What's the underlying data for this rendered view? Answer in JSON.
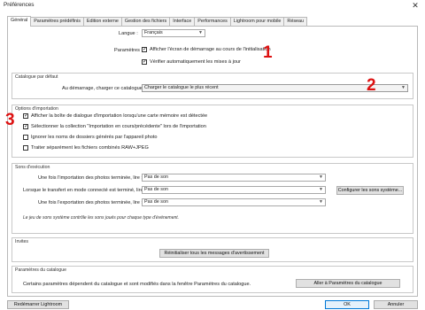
{
  "window": {
    "title": "Préférences",
    "close_glyph": "✕"
  },
  "tabs": [
    "Général",
    "Paramètres prédéfinis",
    "Edition externe",
    "Gestion des fichiers",
    "Interface",
    "Performances",
    "Lightroom pour mobile",
    "Réseau"
  ],
  "active_tab": 0,
  "general": {
    "language_label": "Langue :",
    "language_value": "Français",
    "params_label": "Paramètres :",
    "show_splash": {
      "label": "Afficher l'écran de démarrage au cours de l'initialisation",
      "checked": true
    },
    "check_updates": {
      "label": "Vérifier automatiquement les mises à jour",
      "checked": true
    }
  },
  "default_catalog": {
    "title": "Catalogue par défaut",
    "startup_label": "Au démarrage, charger ce catalogue :",
    "startup_value": "Charger le catalogue le plus récent"
  },
  "import_options": {
    "title": "Options d'importation",
    "items": [
      {
        "label": "Afficher la boîte de dialogue d'importation lorsqu'une carte mémoire est détectée",
        "checked": true
      },
      {
        "label": "Sélectionner la collection \"Importation en cours/précédente\" lors de l'importation",
        "checked": true
      },
      {
        "label": "Ignorer les noms de dossiers générés par l'appareil photo",
        "checked": false
      },
      {
        "label": "Traiter séparément les fichiers combinés RAW+JPEG",
        "checked": false
      }
    ]
  },
  "sounds": {
    "title": "Sons d'exécution",
    "rows": [
      {
        "label": "Une fois l'importation des photos terminée, lire :",
        "value": "Pas de son"
      },
      {
        "label": "Lorsque le transfert en mode connecté est terminé, lire :",
        "value": "Pas de son"
      },
      {
        "label": "Une fois l'exportation des photos terminée, lire :",
        "value": "Pas de son"
      }
    ],
    "config_button": "Configurer les sons système...",
    "note": "Le jeu de sons système contrôle les sons joués pour chaque type d'événement."
  },
  "prompts": {
    "title": "Invites",
    "reset_button": "Réinitialiser tous les messages d'avertissement"
  },
  "catalog_settings": {
    "title": "Paramètres du catalogue",
    "text": "Certains paramètres dépendent du catalogue et sont modifiés dans la fenêtre Paramètres du catalogue.",
    "button": "Aller à Paramètres du catalogue"
  },
  "footer": {
    "restart": "Redémarrer Lightroom",
    "ok": "OK",
    "cancel": "Annuler"
  },
  "annotations": [
    "1",
    "2",
    "3"
  ],
  "colors": {
    "annotation": "#dd1111",
    "focus": "#0078d7"
  }
}
